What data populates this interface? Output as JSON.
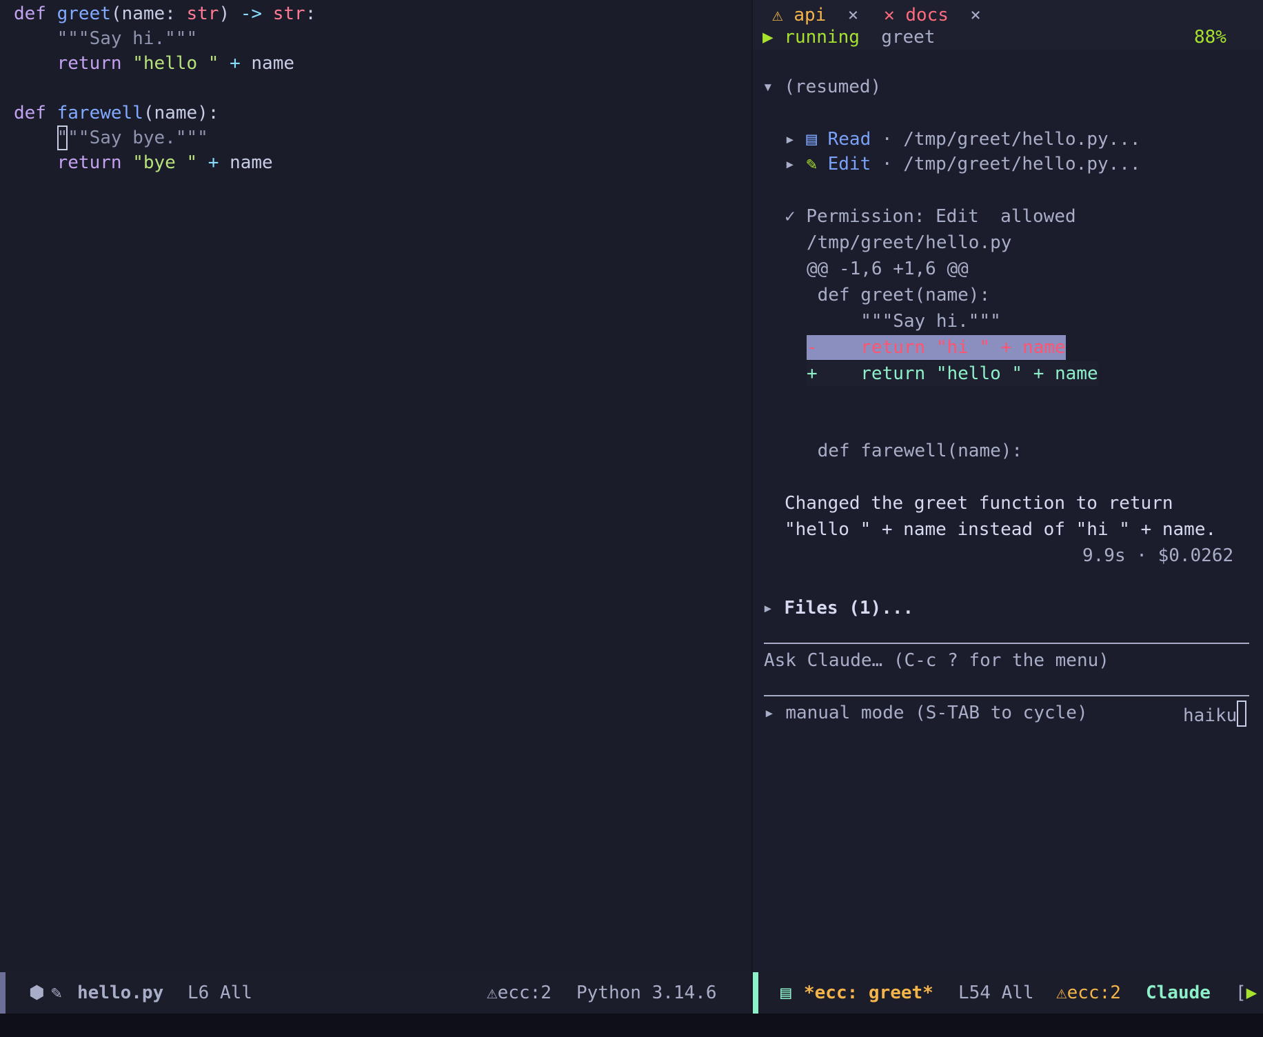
{
  "editor": {
    "code_lines": [
      {
        "kw": "def ",
        "fn": "greet",
        "rest1": "(name: ",
        "ty1": "str",
        "rest2": ") ",
        "op": "->",
        "sp": " ",
        "ty2": "str",
        "end": ":"
      },
      {
        "doc": "    \"\"\"Say hi.\"\"\""
      },
      {
        "kw": "    return ",
        "str": "\"hello \"",
        "op": " + ",
        "plain": "name"
      },
      {
        "empty": ""
      },
      {
        "kw": "def ",
        "fn": "farewell",
        "rest": "(name):"
      },
      {
        "indent": "    ",
        "cursor": "\"",
        "doc": "\"\"Say bye.\"\"\""
      },
      {
        "kw": "    return ",
        "str": "\"bye \"",
        "op": " + ",
        "plain": "name"
      }
    ]
  },
  "claude": {
    "tabs": [
      {
        "icon": "warning-icon",
        "label": "api",
        "close": "×"
      },
      {
        "icon": "error-icon",
        "label": "docs",
        "close": "×"
      }
    ],
    "header": {
      "state": "running",
      "task": "greet",
      "percent": "88%"
    },
    "session_label": "(resumed)",
    "tools": [
      {
        "label": "Read",
        "path": "· /tmp/greet/hello.py..."
      },
      {
        "label": "Edit",
        "path": "· /tmp/greet/hello.py..."
      }
    ],
    "permission": {
      "check": "✓",
      "text": "Permission: Edit  allowed",
      "file": "/tmp/greet/hello.py"
    },
    "diff": {
      "hunk": "@@ -1,6 +1,6 @@",
      "ctx1": " def greet(name):",
      "ctx2": "     \"\"\"Say hi.\"\"\"",
      "del": "-    return \"hi \" + name",
      "add": "+    return \"hello \" + name",
      "ctx3": " def farewell(name):"
    },
    "summary_line1": "Changed the greet function to return",
    "summary_line2": "\"hello \" + name instead of \"hi \" + name.",
    "cost": "9.9s · $0.0262",
    "files_label": "Files (1)...",
    "prompt_placeholder": "Ask Claude… (C-c ? for the menu)",
    "mode_label": "manual mode (S-TAB to cycle)",
    "model": "haiku"
  },
  "status_left": {
    "filename": "hello.py",
    "position": "L6 All",
    "lint": "ecc:2",
    "interpreter": "Python 3.14.6"
  },
  "status_right": {
    "buffer": "*ecc: greet*",
    "position": "L54 All",
    "lint": "ecc:2",
    "mode": "Claude",
    "bracket": "["
  },
  "colors": {
    "background": "#1a1b2a",
    "accent": "#8ef0c8",
    "warning": "#f5b449",
    "error": "#ff6b7d"
  }
}
